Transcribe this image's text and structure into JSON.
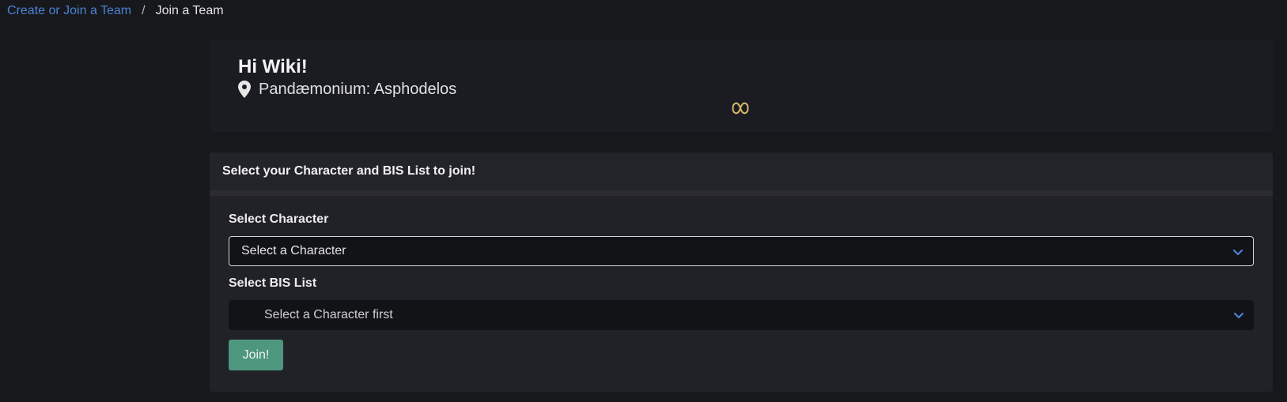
{
  "breadcrumb": {
    "items": [
      "Create or Join a Team",
      "Join a Team"
    ],
    "separator": "/"
  },
  "hero": {
    "greeting": "Hi Wiki!",
    "location": "Pandæmonium: Asphodelos",
    "location_icon": "map-pin-icon",
    "logo_icon": "ouroboros-logo-icon"
  },
  "join_card": {
    "header": "Select your Character and BIS List to join!",
    "character_label": "Select Character",
    "character_value": "Select a Character",
    "bis_label": "Select BIS List",
    "bis_value": "Select a Character first",
    "join_label": "Join!"
  },
  "colors": {
    "background": "#17181c",
    "link": "#4a83d4",
    "button": "#4e977f",
    "chevron": "#4a83d4",
    "logo": "#d9b867"
  }
}
